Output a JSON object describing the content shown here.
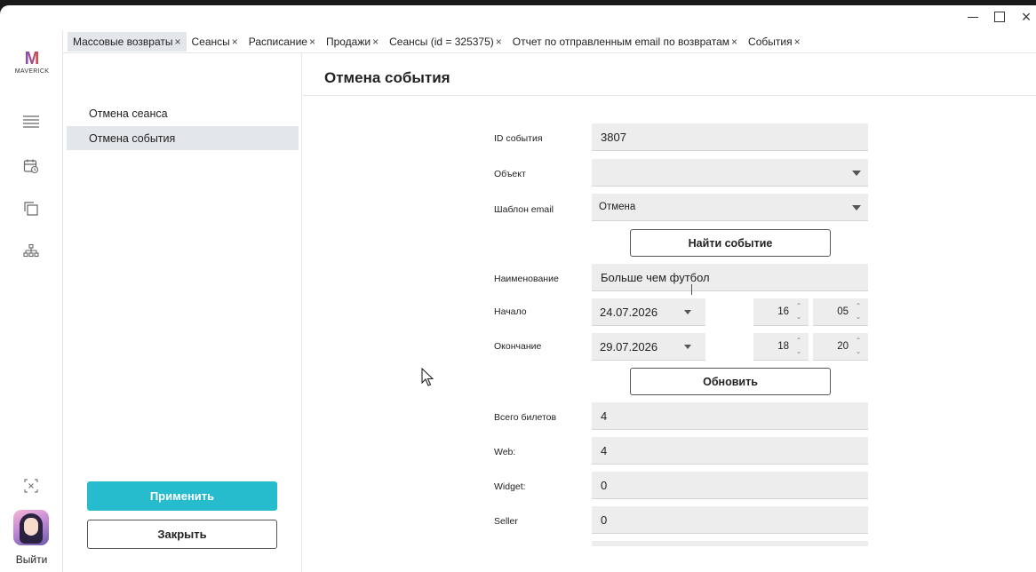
{
  "window_controls": {
    "minimize": "minimize",
    "maximize": "maximize",
    "close": "close"
  },
  "brand": {
    "letter": "M",
    "name": "MAVERICK"
  },
  "rail": {
    "logout_label": "Выйти"
  },
  "tabs": [
    {
      "label": "Массовые возвраты",
      "active": true
    },
    {
      "label": "Сеансы"
    },
    {
      "label": "Расписание"
    },
    {
      "label": "Продажи"
    },
    {
      "label": "Сеансы (id = 325375)"
    },
    {
      "label": "Отчет по отправленным email по возвратам"
    },
    {
      "label": "События"
    }
  ],
  "tab_close_glyph": "×",
  "sidebar": {
    "items": [
      {
        "label": "Отмена сеанса"
      },
      {
        "label": "Отмена события",
        "selected": true
      }
    ],
    "apply_label": "Применить",
    "close_label": "Закрыть"
  },
  "page": {
    "title": "Отмена события"
  },
  "form": {
    "event_id": {
      "label": "ID события",
      "value": "3807"
    },
    "object": {
      "label": "Объект",
      "value": ""
    },
    "email_template": {
      "label": "Шаблон email",
      "value": "Отмена"
    },
    "find_button": "Найти событие",
    "name": {
      "label": "Наименование",
      "value": "Больше чем футбол"
    },
    "start": {
      "label": "Начало",
      "date": "24.07.2026",
      "hour": "16",
      "minute": "05"
    },
    "end": {
      "label": "Окончание",
      "date": "29.07.2026",
      "hour": "18",
      "minute": "20"
    },
    "update_button": "Обновить",
    "total_tickets": {
      "label": "Всего билетов",
      "value": "4"
    },
    "web": {
      "label": "Web:",
      "value": "4"
    },
    "widget": {
      "label": "Widget:",
      "value": "0"
    },
    "seller": {
      "label": "Seller",
      "value": "0"
    }
  },
  "colors": {
    "accent": "#27bccd",
    "selected_bg": "#e3e6ea",
    "field_bg": "#ededed"
  }
}
